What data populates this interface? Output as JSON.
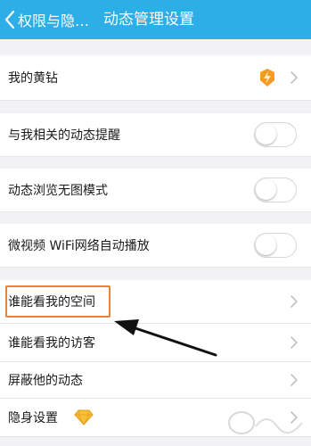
{
  "header": {
    "back_label": "权限与隐…",
    "title": "动态管理设置"
  },
  "rows": [
    {
      "label": "我的黄钻",
      "type": "link",
      "badge": "yellow-diamond-lightning-icon"
    },
    {
      "label": "与我相关的动态提醒",
      "type": "toggle",
      "on": false
    },
    {
      "label": "动态浏览无图模式",
      "type": "toggle",
      "on": false
    },
    {
      "label": "微视频 WiFi网络自动播放",
      "type": "toggle",
      "on": false
    },
    {
      "label": "谁能看我的空间",
      "type": "link",
      "highlighted": true
    },
    {
      "label": "谁能看我的访客",
      "type": "link"
    },
    {
      "label": "屏蔽他的动态",
      "type": "link"
    },
    {
      "label": "隐身设置",
      "type": "link",
      "badge": "diamond-icon"
    }
  ],
  "colors": {
    "header": "#2eaee6",
    "highlight_box": "#e8823a",
    "badge_orange": "#f59a23",
    "diamond_yellow": "#f7c23a"
  }
}
